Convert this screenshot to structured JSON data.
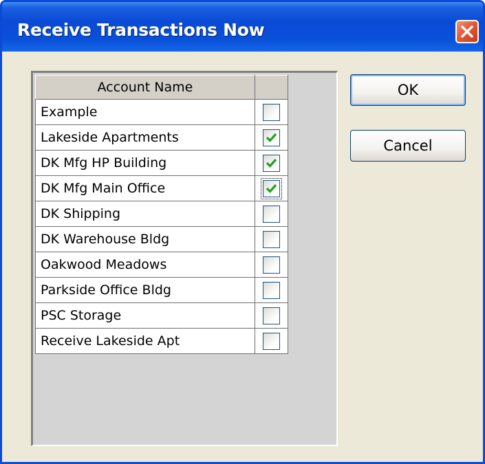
{
  "window": {
    "title": "Receive Transactions Now"
  },
  "grid": {
    "header": {
      "account_name": "Account Name",
      "check": ""
    },
    "rows": [
      {
        "name": "Example",
        "checked": false
      },
      {
        "name": "Lakeside Apartments",
        "checked": true
      },
      {
        "name": "DK Mfg HP Building",
        "checked": true
      },
      {
        "name": "DK Mfg Main Office",
        "checked": true,
        "focused": true
      },
      {
        "name": "DK Shipping",
        "checked": false
      },
      {
        "name": "DK Warehouse Bldg",
        "checked": false
      },
      {
        "name": "Oakwood Meadows",
        "checked": false
      },
      {
        "name": "Parkside Office Bldg",
        "checked": false
      },
      {
        "name": "PSC Storage",
        "checked": false
      },
      {
        "name": "Receive Lakeside Apt",
        "checked": false
      }
    ]
  },
  "buttons": {
    "ok": "OK",
    "cancel": "Cancel"
  },
  "colors": {
    "titlebar": "#0a4ad6",
    "checkmark": "#21a121",
    "face": "#ece9d8"
  }
}
